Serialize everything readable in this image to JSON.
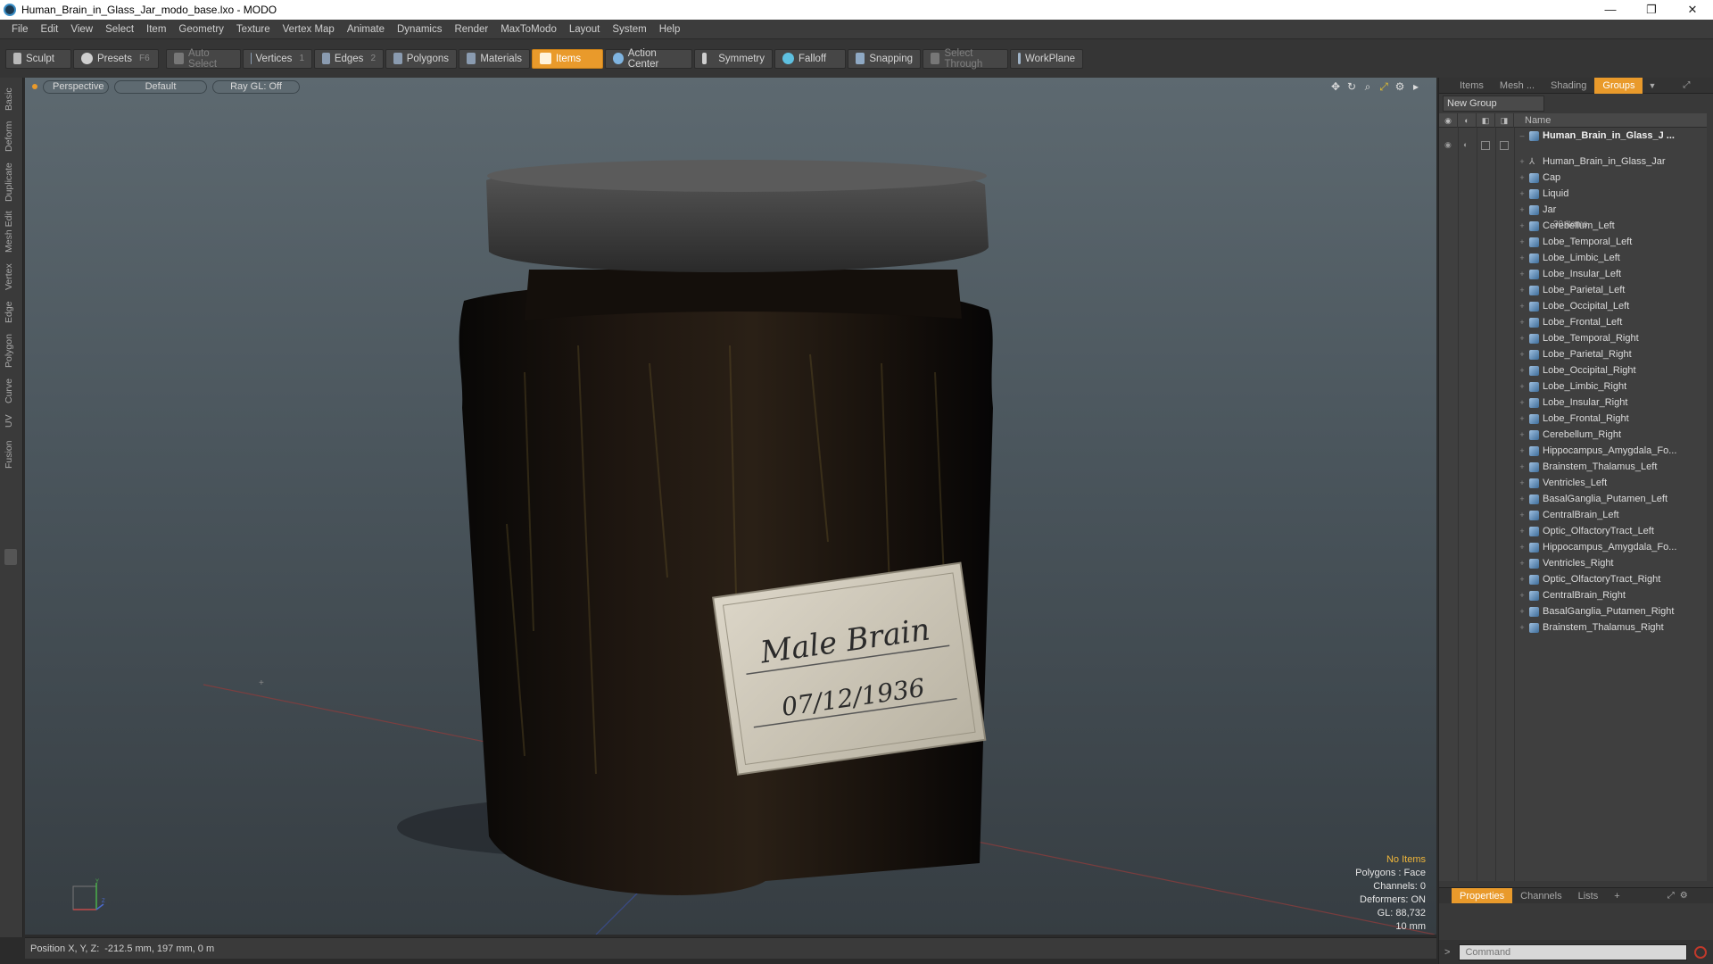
{
  "window": {
    "title": "Human_Brain_in_Glass_Jar_modo_base.lxo - MODO",
    "controls": [
      "—",
      "❐",
      "✕"
    ]
  },
  "menu": [
    "File",
    "Edit",
    "View",
    "Select",
    "Item",
    "Geometry",
    "Texture",
    "Vertex Map",
    "Animate",
    "Dynamics",
    "Render",
    "MaxToModo",
    "Layout",
    "System",
    "Help"
  ],
  "toolbar": {
    "sculpt": "Sculpt",
    "presets": "Presets",
    "presets_key": "F6",
    "auto_select": "Auto Select",
    "vertices": "Vertices",
    "vertices_count": "1",
    "edges": "Edges",
    "edges_count": "2",
    "polygons": "Polygons",
    "materials": "Materials",
    "items": "Items",
    "action_center": "Action Center",
    "symmetry": "Symmetry",
    "falloff": "Falloff",
    "snapping": "Snapping",
    "select_through": "Select Through",
    "workplane": "WorkPlane"
  },
  "left_tabs": [
    "Basic",
    "Deform",
    "Duplicate",
    "Mesh Edit",
    "Vertex",
    "Edge",
    "Polygon",
    "Curve",
    "UV",
    "Fusion"
  ],
  "viewport": {
    "view_mode": "Perspective",
    "shading": "Default",
    "raygl": "Ray GL: Off",
    "label_line1": "Male Brain",
    "label_line2": "07/12/1936",
    "info": {
      "no_items": "No Items",
      "polygons": "Polygons : Face",
      "channels": "Channels: 0",
      "deformers": "Deformers: ON",
      "gl": "GL: 88,732",
      "scale": "10 mm"
    }
  },
  "status": {
    "position_label": "Position X, Y, Z:",
    "position_value": "-212.5 mm, 197 mm, 0 m"
  },
  "right_panel": {
    "tabs": [
      "Items",
      "Mesh ...",
      "Shading",
      "Groups"
    ],
    "active_tab": "Groups",
    "new_group": "New Group",
    "name_header": "Name",
    "root": "Human_Brain_in_Glass_J ...",
    "root_count": "30 Items",
    "items": [
      "Human_Brain_in_Glass_Jar",
      "Cap",
      "Liquid",
      "Jar",
      "Cerebellum_Left",
      "Lobe_Temporal_Left",
      "Lobe_Limbic_Left",
      "Lobe_Insular_Left",
      "Lobe_Parietal_Left",
      "Lobe_Occipital_Left",
      "Lobe_Frontal_Left",
      "Lobe_Temporal_Right",
      "Lobe_Parietal_Right",
      "Lobe_Occipital_Right",
      "Lobe_Limbic_Right",
      "Lobe_Insular_Right",
      "Lobe_Frontal_Right",
      "Cerebellum_Right",
      "Hippocampus_Amygdala_Fo...",
      "Brainstem_Thalamus_Left",
      "Ventricles_Left",
      "BasalGanglia_Putamen_Left",
      "CentralBrain_Left",
      "Optic_OlfactoryTract_Left",
      "Hippocampus_Amygdala_Fo...",
      "Ventricles_Right",
      "Optic_OlfactoryTract_Right",
      "CentralBrain_Right",
      "BasalGanglia_Putamen_Right",
      "Brainstem_Thalamus_Right"
    ],
    "bottom_tabs": [
      "Properties",
      "Channels",
      "Lists",
      "+"
    ],
    "command_placeholder": "Command"
  },
  "colors": {
    "accent": "#e99a2b"
  }
}
